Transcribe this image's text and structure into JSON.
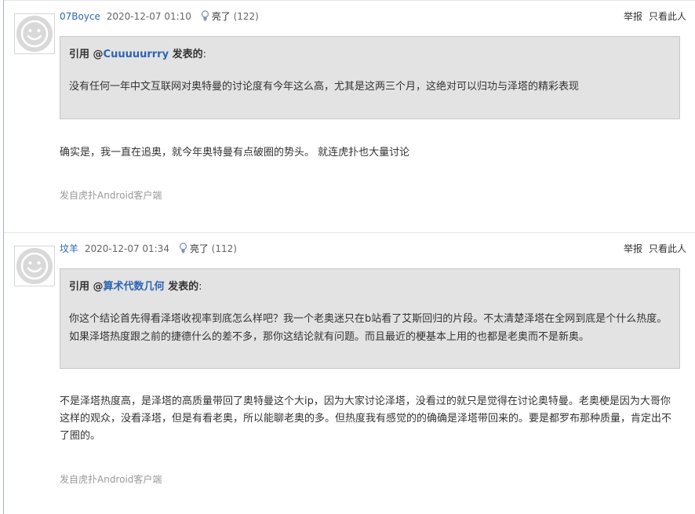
{
  "posts": [
    {
      "username": "07Boyce",
      "timestamp": "2020-12-07 01:10",
      "light_label": "亮了",
      "light_count": "(122)",
      "report_label": "举报",
      "only_author_label": "只看此人",
      "quote": {
        "prefix": "引用 @",
        "user": "Cuuuuurrry",
        "suffix": " 发表的",
        "colon": ":",
        "text": "没有任何一年中文互联网对奥特曼的讨论度有今年这么高，尤其是这两三个月，这绝对可以归功与泽塔的精彩表现"
      },
      "reply": "确实是，我一直在追奥，就今年奥特曼有点破圈的势头。 就连虎扑也大量讨论",
      "source": "发自虎扑Android客户端"
    },
    {
      "username": "坟羊",
      "timestamp": "2020-12-07 01:34",
      "light_label": "亮了",
      "light_count": "(112)",
      "report_label": "举报",
      "only_author_label": "只看此人",
      "quote": {
        "prefix": "引用 @",
        "user": "算术代数几何",
        "suffix": " 发表的",
        "colon": ":",
        "text": "你这个结论首先得看泽塔收视率到底怎么样吧？我一个老奥迷只在b站看了艾斯回归的片段。不太清楚泽塔在全网到底是个什么热度。如果泽塔热度跟之前的捷德什么的差不多，那你这结论就有问题。而且最近的梗基本上用的也都是老奥而不是新奥。"
      },
      "reply": "不是泽塔热度高，是泽塔的高质量带回了奥特曼这个大ip，因为大家讨论泽塔，没看过的就只是觉得在讨论奥特曼。老奥梗是因为大哥你这样的观众，没看泽塔，但是有看老奥，所以能聊老奥的多。但热度我有感觉的的确确是泽塔带回来的。要是都罗布那种质量，肯定出不了圈的。",
      "source": "发自虎扑Android客户端"
    }
  ],
  "icons": {
    "avatar": "default-avatar-icon",
    "light": "lightbulb-icon"
  },
  "colors": {
    "link": "#2d64b3",
    "quote_bg": "#e3e3e3",
    "muted": "#999999"
  }
}
